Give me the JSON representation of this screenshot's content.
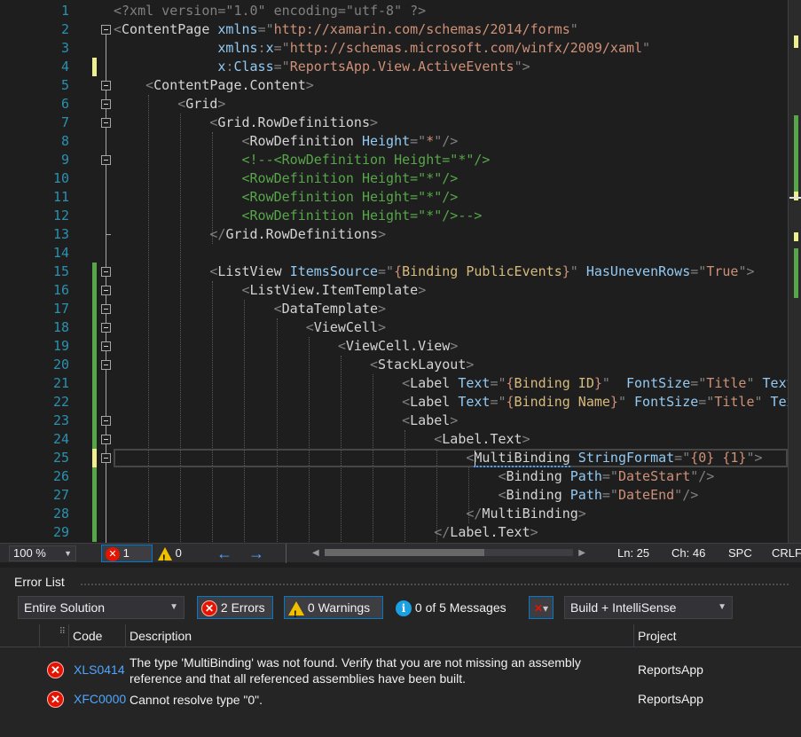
{
  "editor": {
    "lines": [
      {
        "n": "1",
        "mod": "",
        "tokens": [
          [
            "c-p",
            "<?xml version=\"1.0\" encoding=\"utf-8\" ?>"
          ]
        ]
      },
      {
        "n": "2",
        "mod": "",
        "tokens": [
          [
            "c-p",
            "<"
          ],
          [
            "c-x",
            "ContentPage "
          ],
          [
            "c-a",
            "xmlns"
          ],
          [
            "c-p",
            "=\""
          ],
          [
            "c-v",
            "http://xamarin.com/schemas/2014/forms"
          ],
          [
            "c-p",
            "\""
          ]
        ]
      },
      {
        "n": "3",
        "mod": "",
        "tokens": [
          [
            "c-a",
            "             xmlns"
          ],
          [
            "c-p",
            ":"
          ],
          [
            "c-a",
            "x"
          ],
          [
            "c-p",
            "=\""
          ],
          [
            "c-v",
            "http://schemas.microsoft.com/winfx/2009/xaml"
          ],
          [
            "c-p",
            "\""
          ]
        ]
      },
      {
        "n": "4",
        "mod": "unsaved",
        "tokens": [
          [
            "c-a",
            "             x"
          ],
          [
            "c-p",
            ":"
          ],
          [
            "c-a",
            "Class"
          ],
          [
            "c-p",
            "=\""
          ],
          [
            "c-v",
            "ReportsApp.View.ActiveEvents"
          ],
          [
            "c-p",
            "\">"
          ]
        ]
      },
      {
        "n": "5",
        "mod": "",
        "tokens": [
          [
            "c-p",
            "    <"
          ],
          [
            "c-x",
            "ContentPage.Content"
          ],
          [
            "c-p",
            ">"
          ]
        ]
      },
      {
        "n": "6",
        "mod": "",
        "tokens": [
          [
            "c-p",
            "        <"
          ],
          [
            "c-x",
            "Grid"
          ],
          [
            "c-p",
            ">"
          ]
        ]
      },
      {
        "n": "7",
        "mod": "",
        "tokens": [
          [
            "c-p",
            "            <"
          ],
          [
            "c-x",
            "Grid.RowDefinitions"
          ],
          [
            "c-p",
            ">"
          ]
        ]
      },
      {
        "n": "8",
        "mod": "",
        "tokens": [
          [
            "c-p",
            "                <"
          ],
          [
            "c-x",
            "RowDefinition "
          ],
          [
            "c-a",
            "Height"
          ],
          [
            "c-p",
            "=\""
          ],
          [
            "c-v",
            "*"
          ],
          [
            "c-p",
            "\"/>"
          ]
        ]
      },
      {
        "n": "9",
        "mod": "",
        "tokens": [
          [
            "c-c",
            "                <!--<RowDefinition Height=\"*\"/>"
          ]
        ]
      },
      {
        "n": "10",
        "mod": "",
        "tokens": [
          [
            "c-c",
            "                <RowDefinition Height=\"*\"/>"
          ]
        ]
      },
      {
        "n": "11",
        "mod": "",
        "tokens": [
          [
            "c-c",
            "                <RowDefinition Height=\"*\"/>"
          ]
        ]
      },
      {
        "n": "12",
        "mod": "",
        "tokens": [
          [
            "c-c",
            "                <RowDefinition Height=\"*\"/>-->"
          ]
        ]
      },
      {
        "n": "13",
        "mod": "",
        "tokens": [
          [
            "c-p",
            "            </"
          ],
          [
            "c-x",
            "Grid.RowDefinitions"
          ],
          [
            "c-p",
            ">"
          ]
        ]
      },
      {
        "n": "14",
        "mod": "",
        "tokens": []
      },
      {
        "n": "15",
        "mod": "saved",
        "tokens": [
          [
            "c-p",
            "            <"
          ],
          [
            "c-x",
            "ListView "
          ],
          [
            "c-a",
            "ItemsSource"
          ],
          [
            "c-p",
            "=\""
          ],
          [
            "c-v",
            "{"
          ],
          [
            "c-b",
            "Binding PublicEvents"
          ],
          [
            "c-v",
            "}"
          ],
          [
            "c-p",
            "\" "
          ],
          [
            "c-a",
            "HasUnevenRows"
          ],
          [
            "c-p",
            "=\""
          ],
          [
            "c-v",
            "True"
          ],
          [
            "c-p",
            "\">"
          ]
        ]
      },
      {
        "n": "16",
        "mod": "saved",
        "tokens": [
          [
            "c-p",
            "                <"
          ],
          [
            "c-x",
            "ListView.ItemTemplate"
          ],
          [
            "c-p",
            ">"
          ]
        ]
      },
      {
        "n": "17",
        "mod": "saved",
        "tokens": [
          [
            "c-p",
            "                    <"
          ],
          [
            "c-x",
            "DataTemplate"
          ],
          [
            "c-p",
            ">"
          ]
        ]
      },
      {
        "n": "18",
        "mod": "saved",
        "tokens": [
          [
            "c-p",
            "                        <"
          ],
          [
            "c-x",
            "ViewCell"
          ],
          [
            "c-p",
            ">"
          ]
        ]
      },
      {
        "n": "19",
        "mod": "saved",
        "tokens": [
          [
            "c-p",
            "                            <"
          ],
          [
            "c-x",
            "ViewCell.View"
          ],
          [
            "c-p",
            ">"
          ]
        ]
      },
      {
        "n": "20",
        "mod": "saved",
        "tokens": [
          [
            "c-p",
            "                                <"
          ],
          [
            "c-x",
            "StackLayout"
          ],
          [
            "c-p",
            ">"
          ]
        ]
      },
      {
        "n": "21",
        "mod": "saved",
        "tokens": [
          [
            "c-p",
            "                                    <"
          ],
          [
            "c-x",
            "Label "
          ],
          [
            "c-a",
            "Text"
          ],
          [
            "c-p",
            "=\""
          ],
          [
            "c-v",
            "{"
          ],
          [
            "c-b",
            "Binding ID"
          ],
          [
            "c-v",
            "}"
          ],
          [
            "c-p",
            "\"  "
          ],
          [
            "c-a",
            "FontSize"
          ],
          [
            "c-p",
            "=\""
          ],
          [
            "c-v",
            "Title"
          ],
          [
            "c-p",
            "\" "
          ],
          [
            "c-a",
            "TextColor"
          ]
        ]
      },
      {
        "n": "22",
        "mod": "saved",
        "tokens": [
          [
            "c-p",
            "                                    <"
          ],
          [
            "c-x",
            "Label "
          ],
          [
            "c-a",
            "Text"
          ],
          [
            "c-p",
            "=\""
          ],
          [
            "c-v",
            "{"
          ],
          [
            "c-b",
            "Binding Name"
          ],
          [
            "c-v",
            "}"
          ],
          [
            "c-p",
            "\" "
          ],
          [
            "c-a",
            "FontSize"
          ],
          [
            "c-p",
            "=\""
          ],
          [
            "c-v",
            "Title"
          ],
          [
            "c-p",
            "\" "
          ],
          [
            "c-a",
            "TextColor"
          ]
        ]
      },
      {
        "n": "23",
        "mod": "saved",
        "tokens": [
          [
            "c-p",
            "                                    <"
          ],
          [
            "c-x",
            "Label"
          ],
          [
            "c-p",
            ">"
          ]
        ]
      },
      {
        "n": "24",
        "mod": "saved",
        "tokens": [
          [
            "c-p",
            "                                        <"
          ],
          [
            "c-x",
            "Label.Text"
          ],
          [
            "c-p",
            ">"
          ]
        ]
      },
      {
        "n": "25",
        "mod": "unsaved",
        "tokens": [
          [
            "c-p",
            "                                            <"
          ],
          [
            "c-x",
            "MultiBinding "
          ],
          [
            "c-a",
            "StringFormat"
          ],
          [
            "c-p",
            "=\""
          ],
          [
            "c-v",
            "{0} {1}"
          ],
          [
            "c-p",
            "\">"
          ]
        ]
      },
      {
        "n": "26",
        "mod": "saved",
        "tokens": [
          [
            "c-p",
            "                                                <"
          ],
          [
            "c-x",
            "Binding "
          ],
          [
            "c-a",
            "Path"
          ],
          [
            "c-p",
            "=\""
          ],
          [
            "c-v",
            "DateStart"
          ],
          [
            "c-p",
            "\"/>"
          ]
        ]
      },
      {
        "n": "27",
        "mod": "saved",
        "tokens": [
          [
            "c-p",
            "                                                <"
          ],
          [
            "c-x",
            "Binding "
          ],
          [
            "c-a",
            "Path"
          ],
          [
            "c-p",
            "=\""
          ],
          [
            "c-v",
            "DateEnd"
          ],
          [
            "c-p",
            "\"/>"
          ]
        ]
      },
      {
        "n": "28",
        "mod": "saved",
        "tokens": [
          [
            "c-p",
            "                                            </"
          ],
          [
            "c-x",
            "MultiBinding"
          ],
          [
            "c-p",
            ">"
          ]
        ]
      },
      {
        "n": "29",
        "mod": "saved",
        "tokens": [
          [
            "c-p",
            "                                        </"
          ],
          [
            "c-x",
            "Label.Text"
          ],
          [
            "c-p",
            ">"
          ]
        ]
      }
    ]
  },
  "statusbar": {
    "zoom": "100 %",
    "errors": "1",
    "warnings": "0",
    "line": "Ln: 25",
    "col": "Ch: 46",
    "spacing": "SPC",
    "line_ending": "CRLF"
  },
  "error_list": {
    "title": "Error List",
    "scope": "Entire Solution",
    "errors_btn": "2 Errors",
    "warnings_btn": "0 Warnings",
    "messages_btn": "0 of 5 Messages",
    "source": "Build + IntelliSense",
    "columns": {
      "code": "Code",
      "description": "Description",
      "project": "Project"
    },
    "rows": [
      {
        "code": "XLS0414",
        "description": "The type 'MultiBinding' was not found. Verify that you are not missing an assembly reference and that all referenced assemblies have been built.",
        "project": "ReportsApp"
      },
      {
        "code": "XFC0000",
        "description": "Cannot resolve type \"0\".",
        "project": "ReportsApp"
      }
    ]
  },
  "colors": {
    "accent": "#007acc",
    "error": "#e51400",
    "warning": "#f0c000",
    "info": "#1ba1e2",
    "saved_change": "#57a64a",
    "unsaved_change": "#efef91"
  }
}
